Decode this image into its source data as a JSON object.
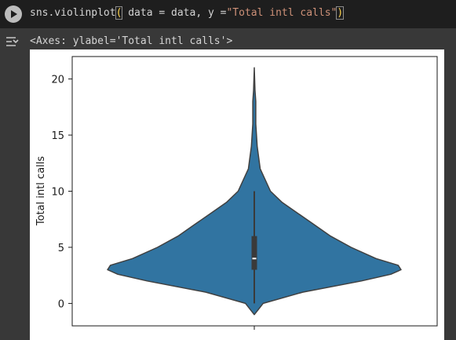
{
  "code_cell": {
    "run_icon": "play-icon",
    "code_prefix": "sns.violinplot",
    "code_open_paren": "(",
    "code_middle": " data = data, y =",
    "code_string": "\"Total intl calls\"",
    "code_close_paren": ")"
  },
  "output": {
    "toggle_icon": "output-collapse-icon",
    "repr_text": "<Axes: ylabel='Total intl calls'>"
  },
  "colors": {
    "violin_fill": "#3174a1",
    "violin_edge": "#404040",
    "box_color": "#3a3a3a",
    "median_color": "#ffffff"
  },
  "chart_data": {
    "type": "violin",
    "title": "",
    "xlabel": "",
    "ylabel": "Total intl calls",
    "ylim": [
      -2,
      22
    ],
    "yticks": [
      0,
      5,
      10,
      15,
      20
    ],
    "ytick_labels": [
      "0",
      "5",
      "10",
      "15",
      "20"
    ],
    "density": [
      {
        "y": -1,
        "w": 0.0
      },
      {
        "y": -0.5,
        "w": 0.03
      },
      {
        "y": 0,
        "w": 0.06
      },
      {
        "y": 1,
        "w": 0.33
      },
      {
        "y": 2,
        "w": 0.73
      },
      {
        "y": 2.6,
        "w": 0.93
      },
      {
        "y": 3,
        "w": 1.0
      },
      {
        "y": 3.4,
        "w": 0.98
      },
      {
        "y": 4,
        "w": 0.83
      },
      {
        "y": 5,
        "w": 0.66
      },
      {
        "y": 6,
        "w": 0.52
      },
      {
        "y": 7,
        "w": 0.41
      },
      {
        "y": 8,
        "w": 0.3
      },
      {
        "y": 9,
        "w": 0.19
      },
      {
        "y": 10,
        "w": 0.11
      },
      {
        "y": 12,
        "w": 0.04
      },
      {
        "y": 14,
        "w": 0.02
      },
      {
        "y": 16,
        "w": 0.01
      },
      {
        "y": 18,
        "w": 0.01
      },
      {
        "y": 19,
        "w": 0.005
      },
      {
        "y": 21,
        "w": 0.0
      }
    ],
    "box": {
      "q1": 3,
      "median": 4,
      "q3": 6,
      "whisker_low": 0,
      "whisker_high": 10
    }
  }
}
